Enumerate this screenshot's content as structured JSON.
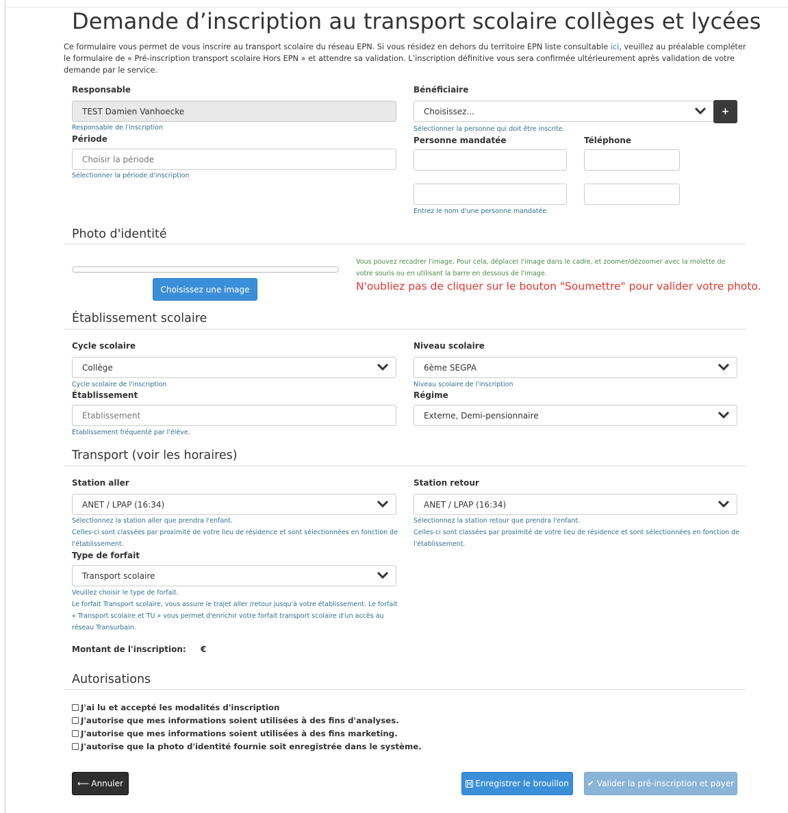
{
  "page": {
    "title": "Demande d’inscription au transport scolaire collèges et lycées",
    "intro_before_link": "Ce formulaire vous permet de vous inscrire au transport scolaire du réseau EPN. Si vous résidez en dehors du territoire EPN liste consultable ",
    "intro_link": "ici",
    "intro_after_link": ", veuillez au préalable compléter le formulaire de « Pré-inscription transport scolaire Hors EPN » et attendre sa validation. L’inscription définitive vous sera confirmée ultérieurement après validation de votre demande par le service."
  },
  "responsable": {
    "label": "Responsable",
    "value": "TEST Damien Vanhoecke",
    "help": "Responsable de l'inscription"
  },
  "beneficiaire": {
    "label": "Bénéficiaire",
    "value": "Choisissez...",
    "help": "Sélectionner la personne qui doit être inscrite.",
    "add_label": "+"
  },
  "periode": {
    "label": "Période",
    "placeholder": "Choisir la période",
    "help": "Sélectionner la période d'inscription"
  },
  "mandataire": {
    "label": "Personne mandatée",
    "phone_label": "Téléphone",
    "help": "Entrez le nom d'une personne mandatée."
  },
  "photo": {
    "section": "Photo d'identité",
    "choose_button": "Choisissez une image",
    "note": "Vous pouvez recadrer l'image. Pour cela, déplacer l'image dans le cadre, et zoomer/dézoomer avec la molette de votre souris ou en utilisant la barre en dessous de l'image.",
    "warning": "N'oubliez pas de cliquer sur le bouton \"Soumettre\" pour valider votre photo."
  },
  "etablissement": {
    "section": "Établissement scolaire",
    "cycle_label": "Cycle scolaire",
    "cycle_value": "Collège",
    "cycle_help": "Cycle scolaire de l'inscription",
    "niveau_label": "Niveau scolaire",
    "niveau_value": "6ème SEGPA",
    "niveau_help": "Niveau scolaire de l'inscription",
    "etab_label": "Établissement",
    "etab_placeholder": "Établissement",
    "etab_help": "Etablissement fréquenté par l'élève.",
    "regime_label": "Régime",
    "regime_value": "Externe, Demi-pensionnaire"
  },
  "transport": {
    "section": "Transport (voir les horaires)",
    "aller_label": "Station aller",
    "aller_value": "ANET / LPAP (16:34)",
    "aller_help": "Sélectionnez la station aller que prendra l'enfant.",
    "aller_help2": "Celles-ci sont classées par proximité de votre lieu de résidence et sont sélectionnées en fonction de l'établissement.",
    "retour_label": "Station retour",
    "retour_value": "ANET / LPAP (16:34)",
    "retour_help": "Sélectionnez la station retour que prendra l'enfant.",
    "retour_help2": "Celles-ci sont classées par proximité de votre lieu de résidence et sont sélectionnées en fonction de l'établissement.",
    "forfait_label": "Type de forfait",
    "forfait_value": "Transport scolaire",
    "forfait_help": "Veuillez choisir le type de forfait.",
    "forfait_help2": "Le forfait Transport scolaire, vous assure le trajet aller /retour jusqu'à votre établissement. Le forfait « Transport scolaire et TU » vous permet d'enrichir votre forfait transport scolaire d'un accès au réseau Transurbain.",
    "montant_label": "Montant de l'inscription:",
    "montant_value": "€"
  },
  "autorisations": {
    "section": "Autorisations",
    "items": [
      "J'ai lu et accepté les modalités d'inscription",
      "J'autorise que mes informations soient utilisées à des fins d'analyses.",
      "J'autorise que mes informations soient utilisées à des fins marketing.",
      "J'autorise que la photo d'identité fournie soit enregistrée dans le système."
    ]
  },
  "actions": {
    "cancel": "Annuler",
    "draft": "Enregistrer le brouillon",
    "validate": "Valider la pré-inscription et payer"
  },
  "colors": {
    "primary": "#3b8fd9",
    "help_text": "#31708f",
    "warning": "#e0362f",
    "dark_button": "#2f2f2f",
    "disabled_primary": "#8ab4d8"
  }
}
